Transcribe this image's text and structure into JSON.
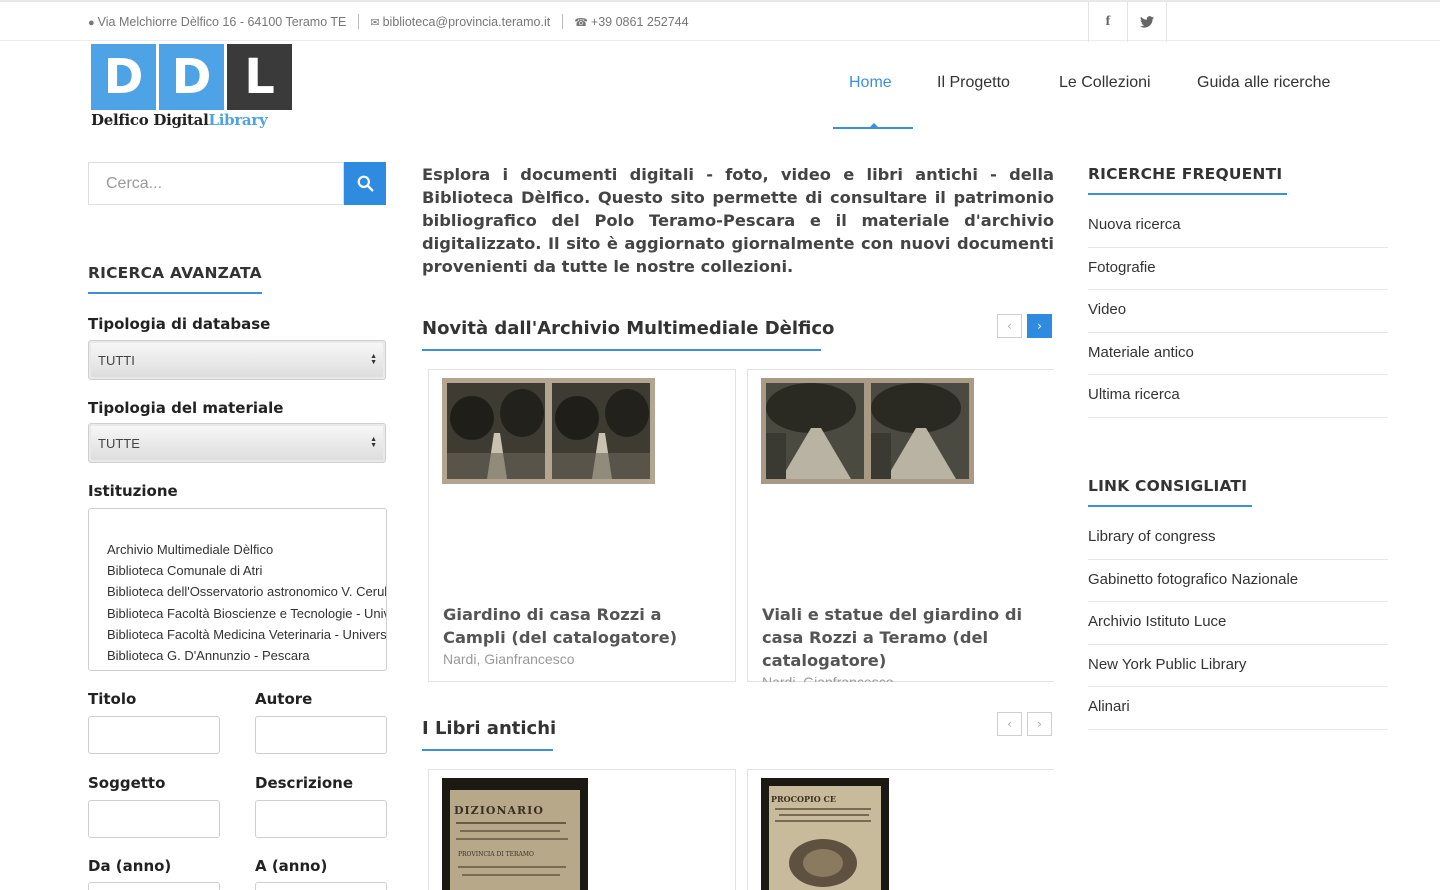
{
  "topbar": {
    "address": "Via Melchiorre Dèlfico 16 - 64100 Teramo TE",
    "email": "biblioteca@provincia.teramo.it",
    "phone": "+39 0861 252744",
    "social": [
      {
        "icon": "facebook-icon",
        "glyph": "f"
      },
      {
        "icon": "twitter-icon",
        "glyph": "t"
      }
    ]
  },
  "logo": {
    "letters": [
      "D",
      "D",
      "L"
    ],
    "name_part1": "Delfico Digital",
    "name_part2": "Library"
  },
  "nav": {
    "items": [
      {
        "label": "Home",
        "active": true
      },
      {
        "label": "Il Progetto",
        "active": false
      },
      {
        "label": "Le Collezioni",
        "active": false
      },
      {
        "label": "Guida alle ricerche",
        "active": false
      }
    ]
  },
  "search": {
    "placeholder": "Cerca...",
    "button_icon": "search-icon"
  },
  "advanced": {
    "title": "RICERCA AVANZATA",
    "database_label": "Tipologia di database",
    "database_value": "TUTTI",
    "material_label": "Tipologia del materiale",
    "material_value": "TUTTE",
    "institution_label": "Istituzione",
    "institutions": [
      "Archivio Multimediale Dèlfico",
      "Biblioteca Comunale di Atri",
      "Biblioteca dell'Osservatorio astronomico V. Cerulli",
      "Biblioteca Facoltà Bioscienze e Tecnologie - Università",
      "Biblioteca Facoltà Medicina Veterinaria - Università",
      "Biblioteca G. D'Annunzio - Pescara"
    ],
    "title_label": "Titolo",
    "author_label": "Autore",
    "subject_label": "Soggetto",
    "description_label": "Descrizione",
    "from_year_label": "Da (anno)",
    "to_year_label": "A (anno)"
  },
  "intro": "Esplora i documenti digitali - foto, video e libri antichi - della Biblioteca Dèlfico. Questo sito permette di consultare il patrimonio bibliografico del Polo Teramo-Pescara e il materiale d'archivio digitalizzato. Il sito è aggiornato giornalmente con nuovi documenti provenienti da tutte le nostre collezioni.",
  "novita": {
    "title": "Novità dall'Archivio Multimediale Dèlfico",
    "prev_glyph": "‹",
    "next_glyph": "›",
    "cards": [
      {
        "title": "Giardino di casa Rozzi a Campli (del catalogatore)",
        "author": "Nardi, Gianfrancesco"
      },
      {
        "title": "Viali e statue del giardino di casa Rozzi a Teramo (del catalogatore)",
        "author": "Nardi, Gianfrancesco"
      }
    ]
  },
  "libri": {
    "title": "I Libri antichi",
    "prev_glyph": "‹",
    "next_glyph": "›",
    "covers": [
      {
        "text": "DIZIONARIO ... PROVINCIA DI TERAMO"
      },
      {
        "text": "PROCOPIO CE..."
      }
    ]
  },
  "ricerche": {
    "title": "RICERCHE FREQUENTI",
    "items": [
      "Nuova ricerca",
      "Fotografie",
      "Video",
      "Materiale antico",
      "Ultima ricerca"
    ]
  },
  "links": {
    "title": "LINK CONSIGLIATI",
    "items": [
      "Library of congress",
      "Gabinetto fotografico Nazionale",
      "Archivio Istituto Luce",
      "New York Public Library",
      "Alinari"
    ]
  },
  "colors": {
    "accent": "#2f8be0",
    "logo_blue": "#4ea3e6",
    "logo_dark": "#3a3a3a"
  }
}
